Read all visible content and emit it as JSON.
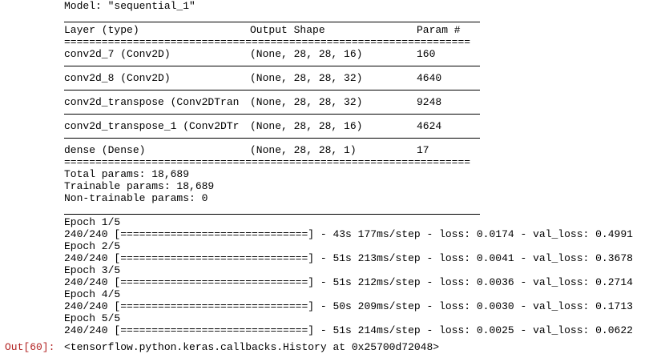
{
  "model_line": "Model: \"sequential_1\"",
  "header": {
    "layer": "Layer (type)",
    "shape": "Output Shape",
    "param": "Param #"
  },
  "double_rule": "=================================================================",
  "layers": [
    {
      "name": "conv2d_7 (Conv2D)",
      "shape": "(None, 28, 28, 16)",
      "params": "160"
    },
    {
      "name": "conv2d_8 (Conv2D)",
      "shape": "(None, 28, 28, 32)",
      "params": "4640"
    },
    {
      "name": "conv2d_transpose (Conv2DTran",
      "shape": "(None, 28, 28, 32)",
      "params": "9248"
    },
    {
      "name": "conv2d_transpose_1 (Conv2DTr",
      "shape": "(None, 28, 28, 16)",
      "params": "4624"
    },
    {
      "name": "dense (Dense)",
      "shape": "(None, 28, 28, 1)",
      "params": "17"
    }
  ],
  "totals": {
    "total": "Total params: 18,689",
    "trainable": "Trainable params: 18,689",
    "non_trainable": "Non-trainable params: 0"
  },
  "epochs": [
    {
      "label": "Epoch 1/5",
      "progress": "240/240 [==============================] - 43s 177ms/step - loss: 0.0174 - val_loss: 0.4991"
    },
    {
      "label": "Epoch 2/5",
      "progress": "240/240 [==============================] - 51s 213ms/step - loss: 0.0041 - val_loss: 0.3678"
    },
    {
      "label": "Epoch 3/5",
      "progress": "240/240 [==============================] - 51s 212ms/step - loss: 0.0036 - val_loss: 0.2714"
    },
    {
      "label": "Epoch 4/5",
      "progress": "240/240 [==============================] - 50s 209ms/step - loss: 0.0030 - val_loss: 0.1713"
    },
    {
      "label": "Epoch 5/5",
      "progress": "240/240 [==============================] - 51s 214ms/step - loss: 0.0025 - val_loss: 0.0622"
    }
  ],
  "output": {
    "prompt": "Out[60]:",
    "text": "<tensorflow.python.keras.callbacks.History at 0x25700d72048>"
  },
  "colors": {
    "prompt": "#b22222",
    "text": "#000000",
    "background": "#ffffff"
  }
}
